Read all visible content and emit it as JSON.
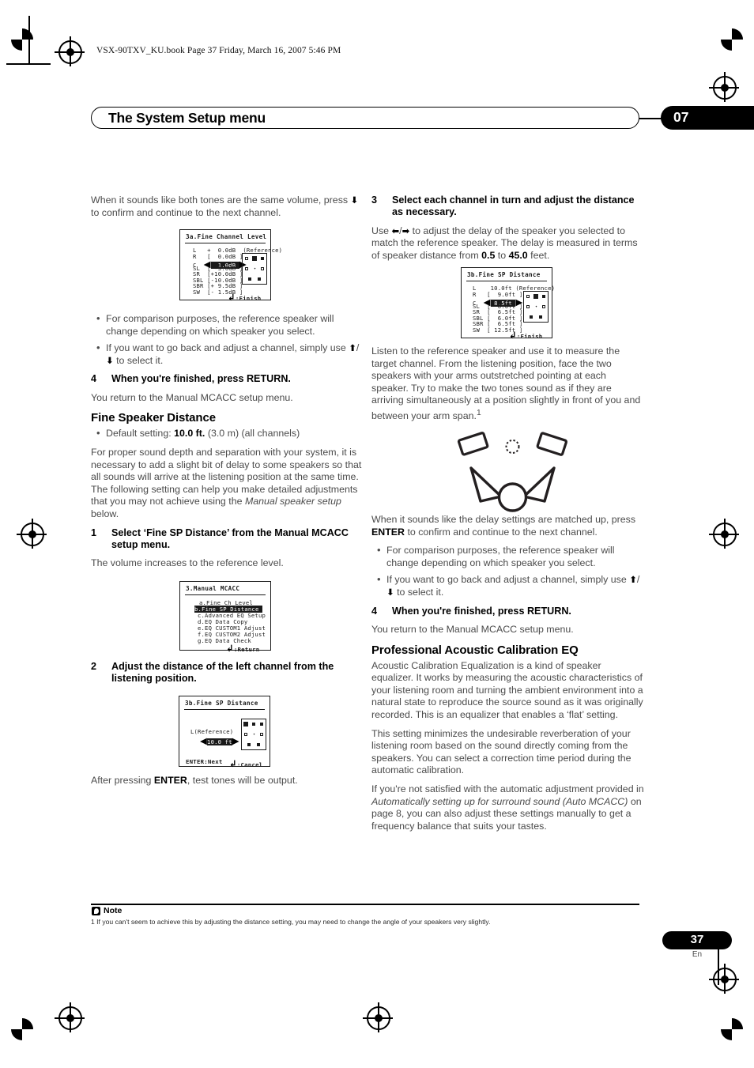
{
  "header": {
    "book_line": "VSX-90TXV_KU.book  Page 37  Friday, March 16, 2007  5:46 PM",
    "running_title": "The System Setup menu",
    "chapter_number": "07"
  },
  "left_column": {
    "intro": "When it sounds like both tones are the same volume, press ↓ to confirm and continue to the next channel.",
    "bullets": [
      "For comparison purposes, the reference speaker will change depending on which speaker you select.",
      "If you want to go back and adjust a channel, simply use ↑/↓ to select it."
    ],
    "step4_num": "4",
    "step4_title": "When you're finished, press RETURN.",
    "step4_body": "You return to the Manual MCACC setup menu.",
    "section_title": "Fine Speaker Distance",
    "default_setting_label": "Default setting:",
    "default_setting_value": "10.0 ft.",
    "default_setting_tail": "(3.0 m) (all channels)",
    "para1": "For proper sound depth and separation with your system, it is necessary to add a slight bit of delay to some speakers so that all sounds will arrive at the listening position at the same time. The following setting can help you make detailed adjustments that you may not achieve using the Manual speaker setup below.",
    "para1_italic": "Manual speaker setup",
    "step1_num": "1",
    "step1_title": "Select ‘Fine SP Distance’ from the Manual MCACC setup menu.",
    "step1_body": "The volume increases to the reference level.",
    "step2_num": "2",
    "step2_title": "Adjust the distance of the left channel from the listening position.",
    "after_enter": "After pressing ENTER, test tones will be output.",
    "after_enter_bold": "ENTER"
  },
  "right_column": {
    "step3_num": "3",
    "step3_title": "Select each channel in turn and adjust the distance as necessary.",
    "step3_body": "Use ←/→ to adjust the delay of the speaker you selected to match the reference speaker. The delay is measured in terms of speaker distance from 0.5 to 45.0 feet.",
    "step3_min": "0.5",
    "step3_max": "45.0",
    "para_listen": "Listen to the reference speaker and use it to measure the target channel. From the listening position, face the two speakers with your arms outstretched pointing at each speaker. Try to make the two tones sound as if they are arriving simultaneously at a position slightly in front of you and between your arm span.",
    "footnote_marker": "1",
    "para_matched": "When it sounds like the delay settings are matched up, press ENTER to confirm and continue to the next channel.",
    "para_matched_bold": "ENTER",
    "bullets": [
      "For comparison purposes, the reference speaker will change depending on which speaker you select.",
      "If you want to go back and adjust a channel, simply use ↑/↓ to select it."
    ],
    "step4_num": "4",
    "step4_title": "When you're finished, press RETURN.",
    "step4_body": "You return to the Manual MCACC setup menu.",
    "section_title": "Professional Acoustic Calibration EQ",
    "para_eq1": "Acoustic Calibration Equalization is a kind of speaker equalizer. It works by measuring the acoustic characteristics of your listening room and turning the ambient environment into a natural state to reproduce the source sound as it was originally recorded. This is an equalizer that enables a ‘flat’ setting.",
    "para_eq2": "This setting minimizes the undesirable reverberation of your listening room based on the sound directly coming from the speakers. You can select a correction time period during the automatic calibration.",
    "para_eq3_a": "If you're not satisfied with the automatic adjustment provided in ",
    "para_eq3_italic": "Automatically setting up for surround sound (Auto MCACC)",
    "para_eq3_b": " on page 8, you can also adjust these settings manually to get a frequency balance that suits your tastes."
  },
  "figures": {
    "fine_channel_level": {
      "title": "3a.Fine Channel Level",
      "rows": [
        {
          "ch": "L",
          "open": "+",
          "value": "0.0dB",
          "close": "",
          "note": "(Reference)",
          "selected": false
        },
        {
          "ch": "R",
          "open": "[",
          "value": "0.0dB",
          "close": "]",
          "note": "",
          "selected": false
        },
        {
          "ch": "C",
          "open": "[",
          "value": "1.0dB",
          "close": "]",
          "note": "",
          "selected": true
        },
        {
          "ch": "SL",
          "open": "[",
          "value": "-3.0dB",
          "close": "]",
          "note": "",
          "selected": false
        },
        {
          "ch": "SR",
          "open": "[",
          "value": "+10.0dB",
          "close": "]",
          "note": "",
          "selected": false
        },
        {
          "ch": "SBL",
          "open": "[",
          "value": "-10.0dB",
          "close": "]",
          "note": "",
          "selected": false
        },
        {
          "ch": "SBR",
          "open": "[",
          "value": "+9.5dB",
          "close": "]",
          "note": "",
          "selected": false
        },
        {
          "ch": "SW",
          "open": "[",
          "value": "-1.5dB",
          "close": "]",
          "note": "",
          "selected": false
        }
      ],
      "footer": ":Finish"
    },
    "fine_sp_distance": {
      "title": "3b.Fine SP Distance",
      "rows": [
        {
          "ch": "L",
          "open": "",
          "value": "10.0ft",
          "close": "",
          "note": "(Reference)",
          "selected": false
        },
        {
          "ch": "R",
          "open": "[",
          "value": "9.0ft",
          "close": "]",
          "note": "",
          "selected": false
        },
        {
          "ch": "C",
          "open": "[",
          "value": "8.5ft",
          "close": "]",
          "note": "",
          "selected": true
        },
        {
          "ch": "SL",
          "open": "[",
          "value": "6.0ft",
          "close": "]",
          "note": "",
          "selected": false
        },
        {
          "ch": "SR",
          "open": "[",
          "value": "6.5ft",
          "close": "]",
          "note": "",
          "selected": false
        },
        {
          "ch": "SBL",
          "open": "[",
          "value": "6.0ft",
          "close": "]",
          "note": "",
          "selected": false
        },
        {
          "ch": "SBR",
          "open": "[",
          "value": "6.5ft",
          "close": "]",
          "note": "",
          "selected": false
        },
        {
          "ch": "SW",
          "open": "[",
          "value": "12.5ft",
          "close": "]",
          "note": "",
          "selected": false
        }
      ],
      "footer": ":Finish"
    },
    "manual_mcacc": {
      "title": "3.Manual MCACC",
      "items": [
        {
          "label": "a.Fine Ch Level",
          "selected": false
        },
        {
          "label": "b.Fine SP Distance",
          "selected": true
        },
        {
          "label": "c.Advanced EQ Setup",
          "selected": false
        },
        {
          "label": "d.EQ Data Copy",
          "selected": false
        },
        {
          "label": "e.EQ CUSTOM1 Adjust",
          "selected": false
        },
        {
          "label": "f.EQ CUSTOM2 Adjust",
          "selected": false
        },
        {
          "label": "g.EQ Data Check",
          "selected": false
        }
      ],
      "footer": ":Return"
    },
    "fine_sp_distance_left": {
      "title": "3b.Fine SP Distance",
      "channel_label": "L(Reference)",
      "value": "10.0 ft",
      "footer_left": "ENTER:Next",
      "footer_right": ":Cancel"
    }
  },
  "footer": {
    "note_label": "Note",
    "note_text": "1  If you can't seem to achieve this by adjusting the distance setting, you may need to change the angle of your speakers very slightly.",
    "page_number": "37",
    "language": "En"
  }
}
